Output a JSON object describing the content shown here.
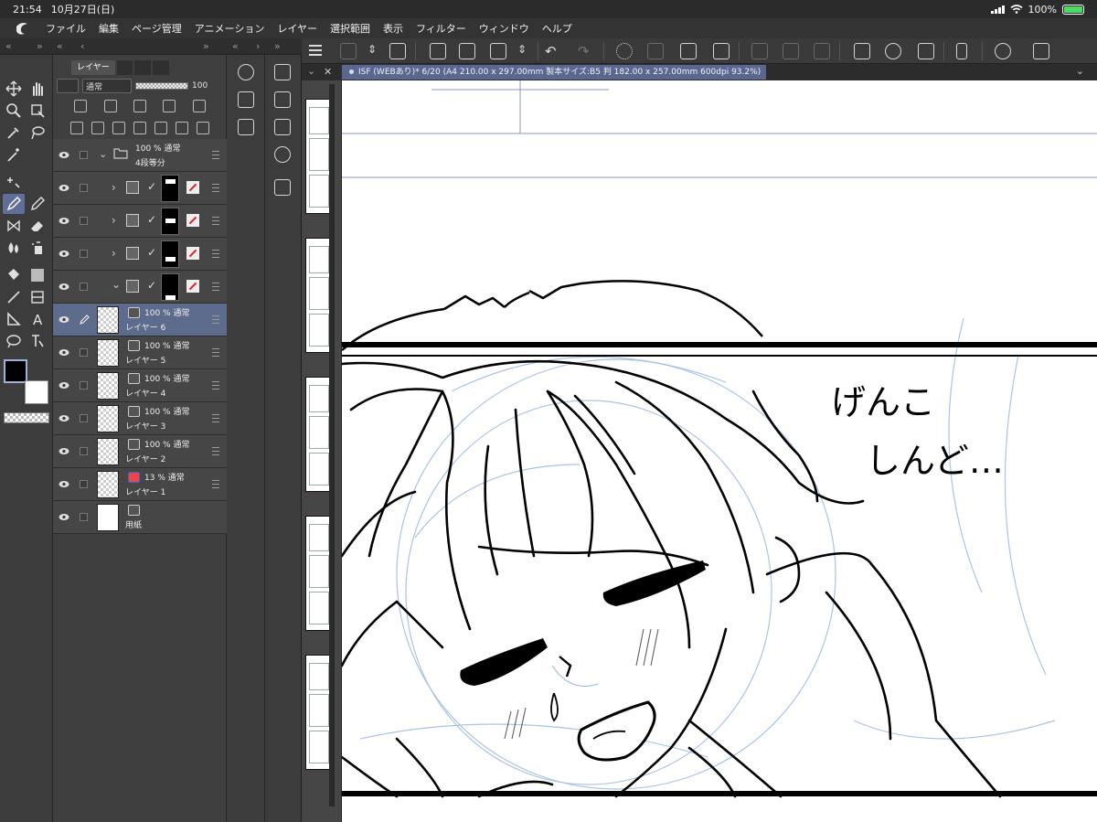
{
  "status_bar": {
    "time": "21:54",
    "date": "10月27日(日)",
    "battery": "100%"
  },
  "menu": [
    "ファイル",
    "編集",
    "ページ管理",
    "アニメーション",
    "レイヤー",
    "選択範囲",
    "表示",
    "フィルター",
    "ウィンドウ",
    "ヘルプ"
  ],
  "layer_panel": {
    "tab_label": "レイヤー",
    "blend_mode": "通常",
    "opacity": "100",
    "folder": {
      "line1": "100 % 通常",
      "line2": "4段等分"
    },
    "layers": [
      {
        "props": "100 % 通常",
        "name": "レイヤー 6"
      },
      {
        "props": "100 % 通常",
        "name": "レイヤー 5"
      },
      {
        "props": "100 % 通常",
        "name": "レイヤー 4"
      },
      {
        "props": "100 % 通常",
        "name": "レイヤー 3"
      },
      {
        "props": "100 % 通常",
        "name": "レイヤー 2"
      },
      {
        "props": "13 % 通常",
        "name": "レイヤー 1"
      }
    ],
    "paper": "用紙"
  },
  "document_tab": "ISF (WEBあり)* 6/20 (A4 210.00 x 297.00mm 製本サイズ:B5 判 182.00 x 257.00mm 600dpi 93.2%)",
  "canvas": {
    "speech_line1": "げんこ",
    "speech_line2": "　しんど…"
  },
  "colors": {
    "accent": "#5d6b8c",
    "doc_tab": "#5a6891",
    "sketch": "#a9c4e4",
    "main_color": "#000000",
    "sub_color": "#ffffff"
  }
}
